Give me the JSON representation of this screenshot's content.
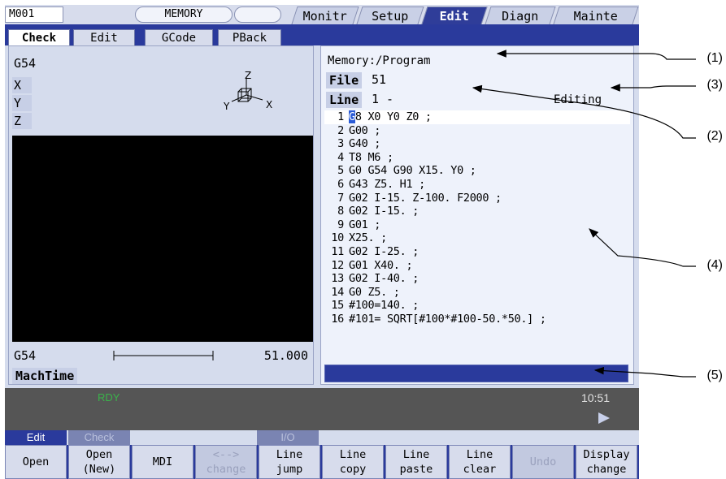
{
  "top_bar": {
    "mode": "M001",
    "memory": "MEMORY",
    "tabs": [
      "Monitr",
      "Setup",
      "Edit",
      "Diagn",
      "Mainte"
    ],
    "active_tab": "Edit"
  },
  "sub_tabs": [
    "Check",
    "Edit",
    "GCode",
    "PBack"
  ],
  "left_pane": {
    "coord_system": "G54",
    "axes": [
      "X",
      "Y",
      "Z"
    ],
    "axis_icon_labels": [
      "Z",
      "Y",
      "X"
    ],
    "bottom_coord": "G54",
    "scale_value": "51.000",
    "machtime_label": "MachTime"
  },
  "right_pane": {
    "path": "Memory:/Program",
    "file_label": "File",
    "file_value": "51",
    "line_label": "Line",
    "line_value": "1 -",
    "status": "Editing",
    "code_lines": [
      {
        "n": "1",
        "text": "G8 X0 Y0 Z0 ;"
      },
      {
        "n": "2",
        "text": "G00 ;"
      },
      {
        "n": "3",
        "text": "G40 ;"
      },
      {
        "n": "4",
        "text": "T8 M6 ;"
      },
      {
        "n": "5",
        "text": "G0 G54 G90 X15. Y0 ;"
      },
      {
        "n": "6",
        "text": "G43 Z5. H1 ;"
      },
      {
        "n": "7",
        "text": "G02 I-15. Z-100. F2000 ;"
      },
      {
        "n": "8",
        "text": "G02 I-15. ;"
      },
      {
        "n": "9",
        "text": "G01 ;"
      },
      {
        "n": "10",
        "text": "X25. ;"
      },
      {
        "n": "11",
        "text": "G02 I-25. ;"
      },
      {
        "n": "12",
        "text": "G01 X40. ;"
      },
      {
        "n": "13",
        "text": "G02 I-40. ;"
      },
      {
        "n": "14",
        "text": "G0 Z5. ;"
      },
      {
        "n": "15",
        "text": "#100=140. ;"
      },
      {
        "n": "16",
        "text": "#101= SQRT[#100*#100-50.*50.] ;"
      }
    ]
  },
  "status_bar": {
    "ready": "RDY",
    "clock": "10:51"
  },
  "menu_groups": {
    "edit": "Edit",
    "check": "Check",
    "io": "I/O"
  },
  "function_keys": [
    {
      "label": "Open",
      "enabled": true
    },
    {
      "label": "Open\n(New)",
      "enabled": true
    },
    {
      "label": "MDI",
      "enabled": true
    },
    {
      "label": "<-->\nchange",
      "enabled": false
    },
    {
      "label": "Line\njump",
      "enabled": true
    },
    {
      "label": "Line\ncopy",
      "enabled": true
    },
    {
      "label": "Line\npaste",
      "enabled": true
    },
    {
      "label": "Line\nclear",
      "enabled": true
    },
    {
      "label": "Undo",
      "enabled": false
    },
    {
      "label": "Display\nchange",
      "enabled": true
    }
  ],
  "callouts": [
    "(1)",
    "(2)",
    "(3)",
    "(4)",
    "(5)"
  ],
  "colors": {
    "accent": "#2a3a9c",
    "active_tab": "#2f3d99",
    "ready": "#3ab34a",
    "cursor": "#2a5bd6"
  }
}
